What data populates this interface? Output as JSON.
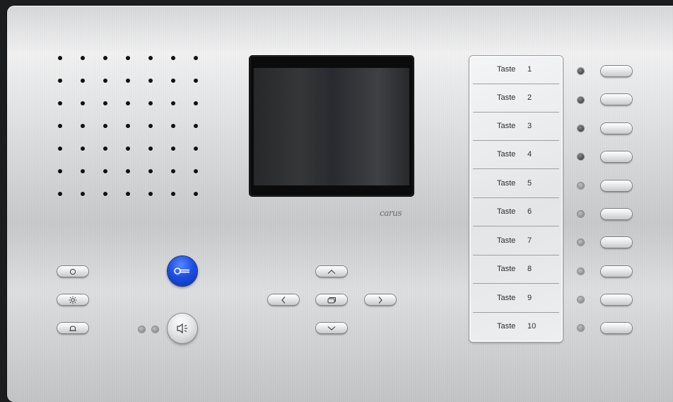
{
  "device": {
    "brand": "carus",
    "grille": {
      "rows": 7,
      "cols": 7
    },
    "call_keys": [
      {
        "label": "Taste",
        "number": "1"
      },
      {
        "label": "Taste",
        "number": "2"
      },
      {
        "label": "Taste",
        "number": "3"
      },
      {
        "label": "Taste",
        "number": "4"
      },
      {
        "label": "Taste",
        "number": "5"
      },
      {
        "label": "Taste",
        "number": "6"
      },
      {
        "label": "Taste",
        "number": "7"
      },
      {
        "label": "Taste",
        "number": "8"
      },
      {
        "label": "Taste",
        "number": "9"
      },
      {
        "label": "Taste",
        "number": "10"
      }
    ],
    "left_buttons": [
      {
        "icon": "circle-icon"
      },
      {
        "icon": "light-icon"
      },
      {
        "icon": "bell-icon"
      }
    ],
    "round_buttons": [
      {
        "icon": "key-icon",
        "color": "#1c50e6"
      },
      {
        "icon": "speaker-icon",
        "color": "#e1e2e3"
      }
    ],
    "nav_buttons": [
      "up-arrow-icon",
      "left-arrow-icon",
      "window-icon",
      "right-arrow-icon",
      "down-arrow-icon"
    ],
    "colors": {
      "door_open_button": "#1c50e6",
      "panel": "#d9dadb"
    }
  }
}
